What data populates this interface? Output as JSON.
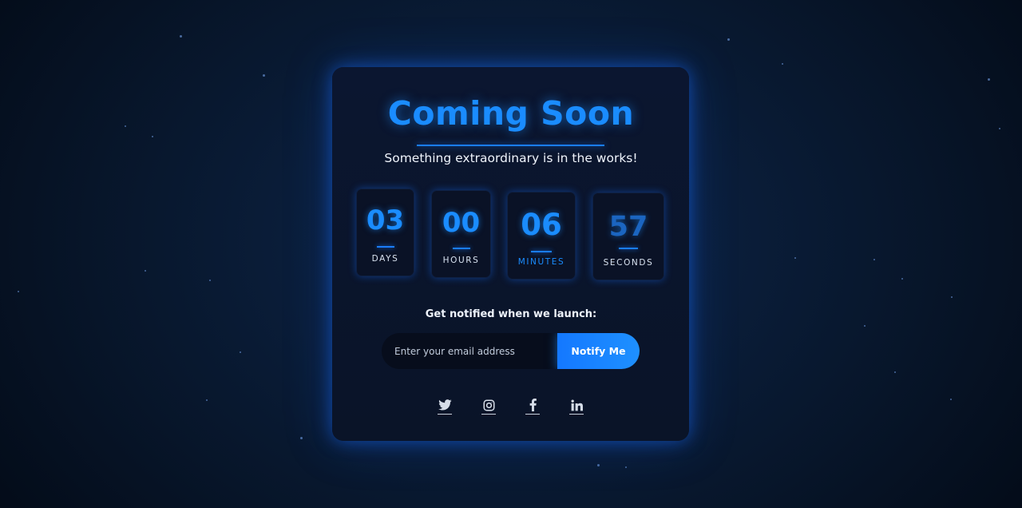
{
  "page": {
    "title": "Coming Soon",
    "subtitle": "Something extraordinary is in the works!"
  },
  "countdown": [
    {
      "key": "days",
      "value": "03",
      "label": "DAYS"
    },
    {
      "key": "hours",
      "value": "00",
      "label": "HOURS"
    },
    {
      "key": "minutes",
      "value": "06",
      "label": "MINUTES"
    },
    {
      "key": "seconds",
      "value": "57",
      "label": "SECONDS"
    }
  ],
  "notify": {
    "label": "Get notified when we launch:",
    "email_placeholder": "Enter your email address",
    "button_label": "Notify Me"
  },
  "socials": [
    {
      "name": "twitter",
      "icon": "twitter-icon"
    },
    {
      "name": "instagram",
      "icon": "instagram-icon"
    },
    {
      "name": "facebook",
      "icon": "facebook-icon"
    },
    {
      "name": "linkedin",
      "icon": "linkedin-icon"
    }
  ],
  "colors": {
    "accent": "#1a8cff",
    "background": "#0a1d39",
    "card": "#0b1630",
    "text": "#eef3fb"
  }
}
